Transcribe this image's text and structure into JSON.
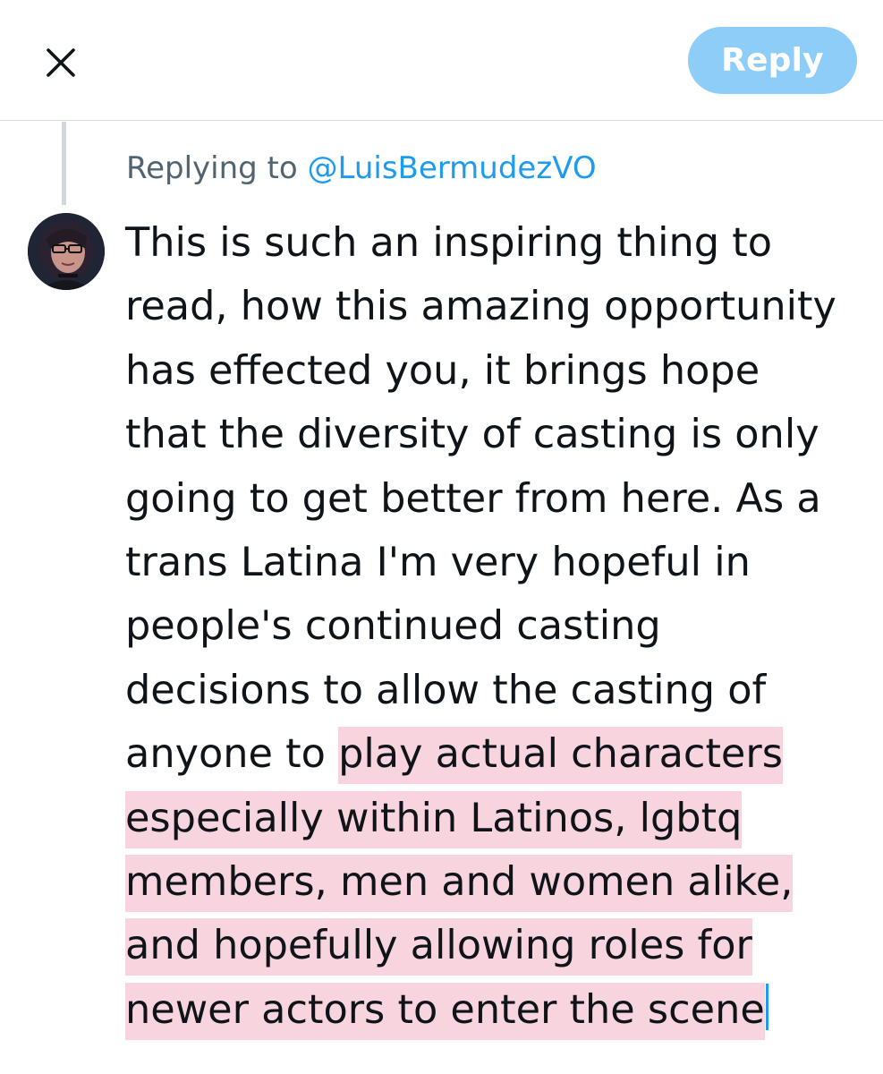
{
  "toolbar": {
    "close_icon": "close-icon",
    "reply_label": "Reply",
    "reply_color": "#8ecdf7"
  },
  "reply_context": {
    "prefix": "Replying to",
    "handle": "@LuisBermudezVO"
  },
  "composer": {
    "text_plain": "This is such an inspiring thing to\nread, how this amazing opportunity\nhas effected you, it brings hope\nthat the diversity of casting is only\ngoing to get better from here. As a\ntrans Latina I'm very hopeful in\npeople's continued casting\ndecisions to allow the casting of\nanyone to ",
    "text_selected": "play actual characters\nespecially within Latinos, lgbtq\nmembers, men and women alike,\nand hopefully allowing roles for\nnewer actors to enter the scene",
    "selection_color": "#f8d4df",
    "caret_color": "#1d9bf0"
  },
  "colors": {
    "accent": "#1d9bf0",
    "muted_text": "#536471",
    "body_text": "#0f1419",
    "divider": "#d8dee3"
  }
}
